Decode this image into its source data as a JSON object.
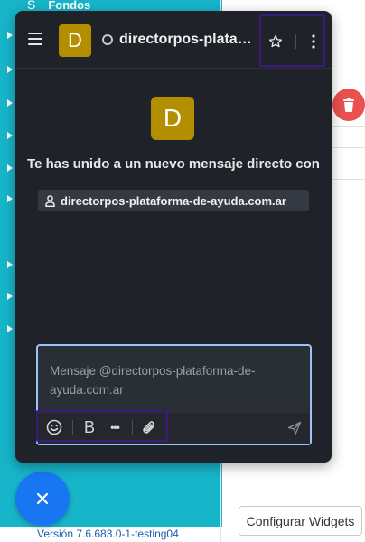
{
  "background": {
    "sidebar_top_item": {
      "icon": "S",
      "label": "Fondos"
    },
    "version": "Versión 7.6.683.0-1-testing04",
    "config_widgets_label": "Configurar Widgets",
    "colors": {
      "sidebar": "#17b5c9",
      "delete": "#e8514f",
      "fab": "#1976f2"
    }
  },
  "chat": {
    "header": {
      "avatar_letter": "D",
      "room_name": "directorpos-plataforma-de-ayuda.com.ar",
      "icons": [
        "menu-icon",
        "status-dot",
        "star-icon",
        "kebab-icon"
      ]
    },
    "welcome": {
      "avatar_letter": "D",
      "joined_text": "Te has unido a un nuevo mensaje directo con",
      "username": "directorpos-plataforma-de-ayuda.com.ar"
    },
    "composer": {
      "placeholder": "Mensaje @directorpos-plataforma-de-ayuda.com.ar",
      "value": "",
      "toolbar": {
        "bold_label": "B",
        "more_label": "•••",
        "icons": [
          "emoji-icon",
          "bold-icon",
          "more-icon",
          "attach-icon",
          "send-icon"
        ]
      }
    },
    "colors": {
      "panel": "#1f2329",
      "avatar": "#b38f00",
      "focus_border": "#9dc2f7",
      "highlight": "#3b1a7e"
    }
  }
}
